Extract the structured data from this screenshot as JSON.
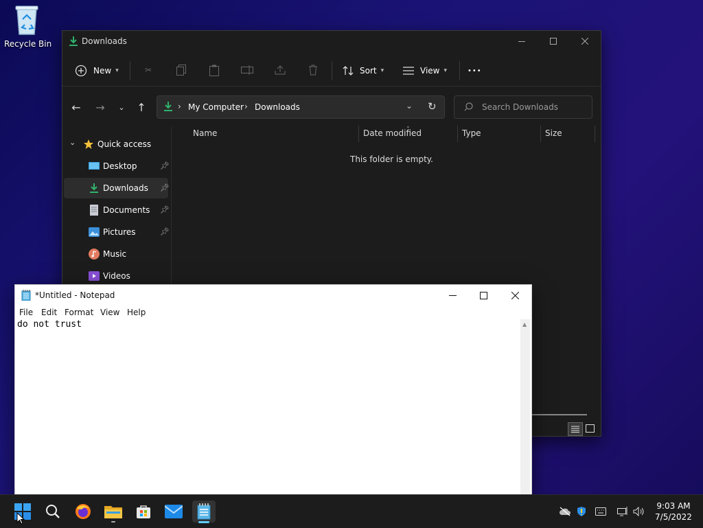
{
  "desktop": {
    "recycle_bin_label": "Recycle Bin"
  },
  "explorer": {
    "title": "Downloads",
    "toolbar": {
      "new_label": "New",
      "sort_label": "Sort",
      "view_label": "View",
      "more_label": "•••"
    },
    "address": {
      "root": "My Computer",
      "current": "Downloads"
    },
    "search": {
      "placeholder": "Search Downloads"
    },
    "sidebar": {
      "quick_access_label": "Quick access",
      "items": [
        {
          "label": "Desktop",
          "icon": "desktop-icon"
        },
        {
          "label": "Downloads",
          "icon": "download-icon"
        },
        {
          "label": "Documents",
          "icon": "document-icon"
        },
        {
          "label": "Pictures",
          "icon": "picture-icon"
        },
        {
          "label": "Music",
          "icon": "music-icon"
        },
        {
          "label": "Videos",
          "icon": "video-icon"
        }
      ]
    },
    "columns": [
      "Name",
      "Date modified",
      "Type",
      "Size"
    ],
    "empty_message": "This folder is empty."
  },
  "notepad": {
    "title": "*Untitled - Notepad",
    "menu": [
      "File",
      "Edit",
      "Format",
      "View",
      "Help"
    ],
    "content": "do not trust "
  },
  "taskbar": {
    "apps": [
      "start-icon",
      "search-icon",
      "firefox-icon",
      "file-explorer-icon",
      "store-icon",
      "mail-icon",
      "notepad-icon"
    ],
    "clock": {
      "time": "9:03 AM",
      "date": "7/5/2022"
    }
  },
  "colors": {
    "accent_green": "#2fb36b",
    "folder_yellow": "#f3c13a",
    "win_blue": "#1e90ff"
  }
}
